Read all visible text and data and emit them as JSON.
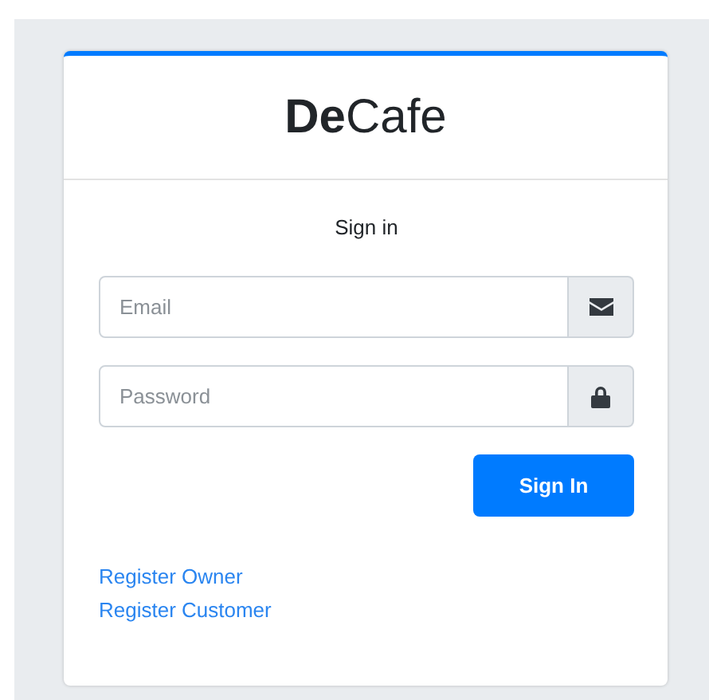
{
  "logo": "**De**Cafe",
  "heading": "Sign in",
  "fields": [
    {
      "placeholder": "Email"
    },
    {
      "placeholder": "Password"
    }
  ],
  "submit": "Sign In",
  "links": [
    "Register Owner",
    "Register Customer"
  ]
}
